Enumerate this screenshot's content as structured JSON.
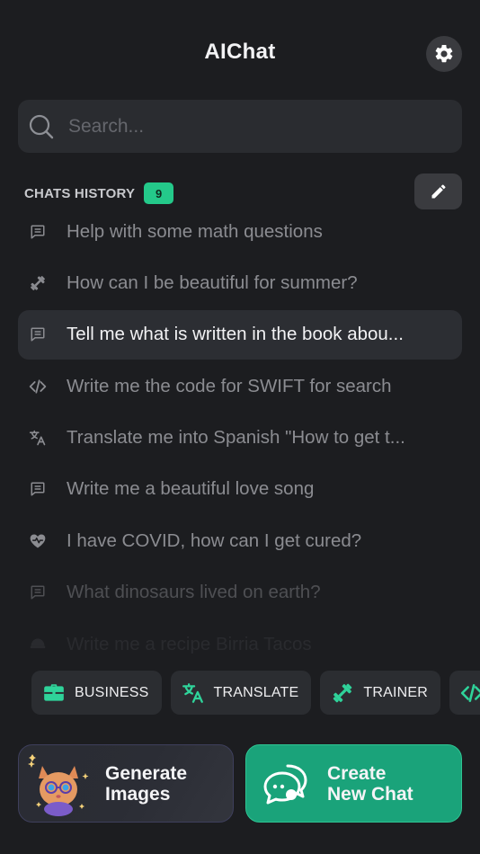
{
  "header": {
    "title": "AIChat"
  },
  "search": {
    "placeholder": "Search..."
  },
  "history": {
    "title": "CHATS HISTORY",
    "count": "9",
    "items": [
      {
        "icon": "message-icon",
        "text": "Help with some math questions",
        "state": "normal"
      },
      {
        "icon": "dumbbell-icon",
        "text": "How can I be beautiful for summer?",
        "state": "normal"
      },
      {
        "icon": "message-icon",
        "text": "Tell me what is written in the book abou...",
        "state": "active"
      },
      {
        "icon": "code-icon",
        "text": "Write me the code for SWIFT for search",
        "state": "normal"
      },
      {
        "icon": "translate-icon",
        "text": "Translate me into Spanish \"How to get t...",
        "state": "normal"
      },
      {
        "icon": "message-icon",
        "text": "Write me a beautiful love song",
        "state": "normal"
      },
      {
        "icon": "heart-pulse-icon",
        "text": "I have COVID, how can I get cured?",
        "state": "normal"
      },
      {
        "icon": "message-icon",
        "text": "What dinosaurs lived on earth?",
        "state": "fade1"
      },
      {
        "icon": "food-icon",
        "text": "Write me a recipe Birria Tacos",
        "state": "fade2"
      }
    ]
  },
  "categories": [
    {
      "icon": "briefcase-icon",
      "label": "BUSINESS"
    },
    {
      "icon": "translate-icon",
      "label": "TRANSLATE"
    },
    {
      "icon": "dumbbell-icon",
      "label": "TRAINER"
    },
    {
      "icon": "code-icon",
      "label": ""
    }
  ],
  "actions": {
    "generate_images": "Generate\nImages",
    "create_new_chat": "Create\nNew Chat"
  },
  "colors": {
    "background": "#1c1d20",
    "accent": "#1aa37a",
    "badge": "#24c98a",
    "icon_accent": "#2fd39a"
  }
}
